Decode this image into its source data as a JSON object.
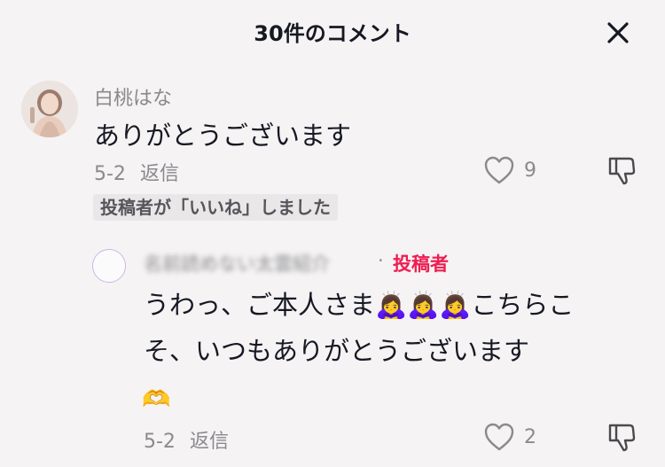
{
  "header": {
    "title": "30件のコメント"
  },
  "comment1": {
    "username": "白桃はな",
    "text": "ありがとうございます",
    "date": "5-2",
    "reply_label": "返信",
    "likes": "9",
    "badge": "投稿者が「いいね」しました"
  },
  "reply1": {
    "username": "名前読めない太雲紹介",
    "separator": "·",
    "author_tag": "投稿者",
    "text": "うわっ、ご本人さま🙇‍♀️🙇‍♀️🙇‍♀️こちらこそ、いつもありがとうございます",
    "emoji_line": "🫶",
    "date": "5-2",
    "reply_label": "返信",
    "likes": "2"
  }
}
